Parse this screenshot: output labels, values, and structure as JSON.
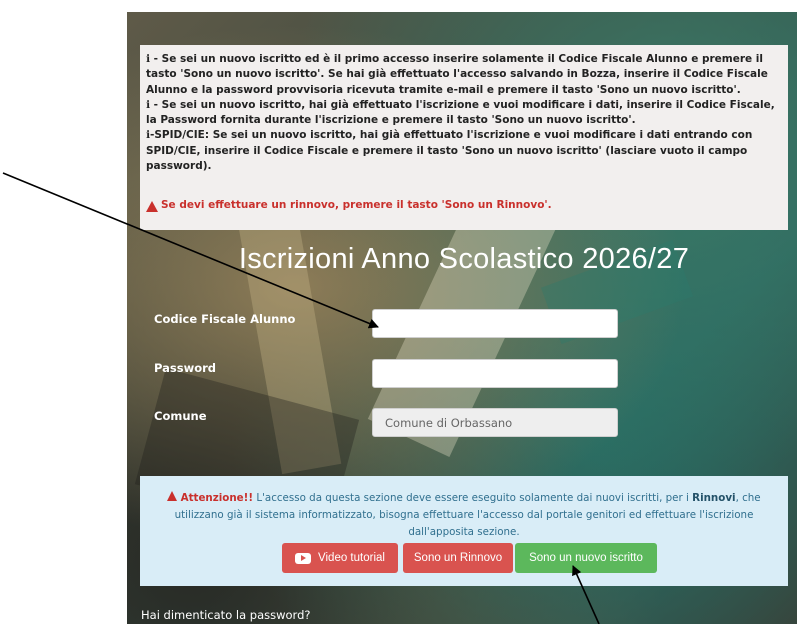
{
  "info": {
    "para1": "ℹ - Se sei un nuovo iscritto ed è il primo accesso inserire solamente il Codice Fiscale Alunno e premere il tasto 'Sono un nuovo iscritto'. Se hai già effettuato l'accesso salvando in Bozza, inserire il Codice Fiscale Alunno e la password provvisoria ricevuta tramite e-mail e premere il tasto 'Sono un nuovo iscritto'.",
    "para2": "ℹ - Se sei un nuovo iscritto, hai già effettuato l'iscrizione e vuoi modificare i dati, inserire il Codice Fiscale, la Password fornita durante l'iscrizione e premere il tasto 'Sono un nuovo iscritto'.",
    "para3": "ℹ-SPID/CIE: Se sei un nuovo iscritto, hai già effettuato l'iscrizione e vuoi modificare i dati entrando con SPID/CIE, inserire il Codice Fiscale e premere il tasto 'Sono un nuovo iscritto' (lasciare vuoto il campo password).",
    "renewal_warning": "Se devi effettuare un rinnovo, premere il tasto 'Sono un Rinnovo'."
  },
  "page_title": "Iscrizioni Anno Scolastico 2026/27",
  "form": {
    "codice_fiscale_label": "Codice Fiscale Alunno",
    "codice_fiscale_value": "",
    "password_label": "Password",
    "password_value": "",
    "comune_label": "Comune",
    "comune_value": "Comune di Orbassano"
  },
  "notice": {
    "attention": "Attenzione!!",
    "text_before": " L'accesso da questa sezione deve essere eseguito solamente dai nuovi iscritti, per i ",
    "rinnovi": "Rinnovi",
    "text_after": ", che utilizzano già il sistema informatizzato, bisogna effettuare l'accesso dal portale genitori ed effettuare l'iscrizione dall'apposita sezione."
  },
  "buttons": {
    "video_tutorial": "Video tutorial",
    "rinnovo": "Sono un Rinnovo",
    "nuovo_iscritto": "Sono un nuovo iscritto"
  },
  "forgot_password": "Hai dimenticato la password?",
  "colors": {
    "danger": "#d9534f",
    "success": "#5cb85c",
    "info_bg": "#d9edf7",
    "info_text": "#31708f",
    "warning_text": "#c9302c"
  }
}
